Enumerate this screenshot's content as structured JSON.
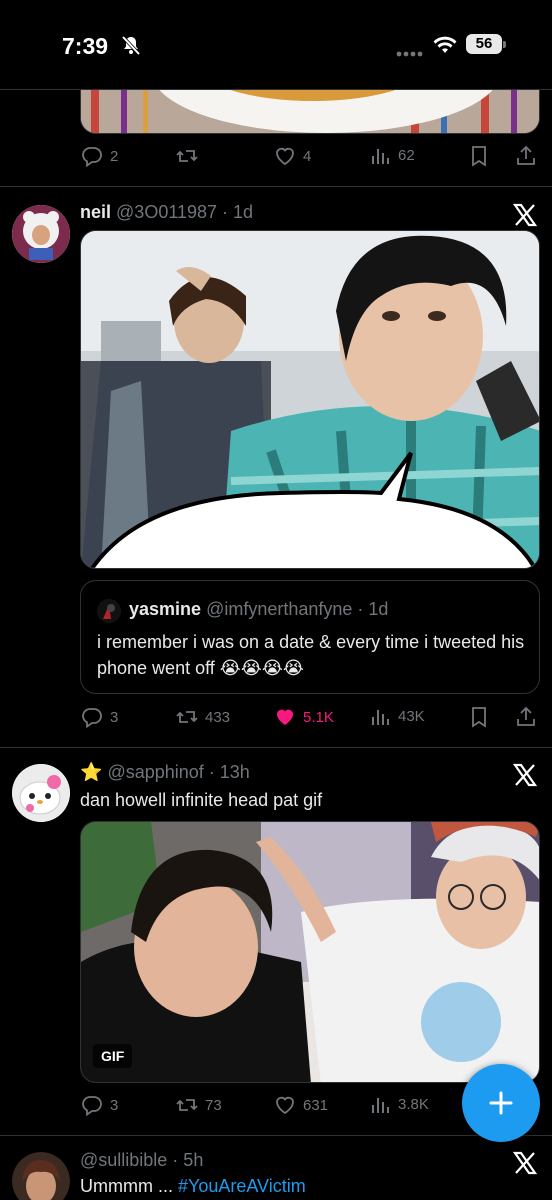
{
  "status_bar": {
    "time": "7:39",
    "battery": "56"
  },
  "tweet1": {
    "actions": {
      "replies": "2",
      "reposts": "",
      "likes": "4",
      "views": "62"
    }
  },
  "tweet2": {
    "name": "neil",
    "handle": "@3O011987 · 1d",
    "quote": {
      "name": "yasmine",
      "handle": "@imfynerthanfyne · 1d",
      "text": "i remember i was on a date & every time i tweeted his phone went off 😭😭😭😭"
    },
    "actions": {
      "replies": "3",
      "reposts": "433",
      "likes": "5.1K",
      "views": "43K"
    },
    "like_color": "#f91880"
  },
  "tweet3": {
    "name_emoji": "⭐",
    "handle": "@sapphinof · 13h",
    "text": "dan howell infinite head pat gif",
    "gif_label": "GIF",
    "actions": {
      "replies": "3",
      "reposts": "73",
      "likes": "631",
      "views": "3.8K"
    }
  },
  "tweet4": {
    "handle": "@sullibible · 5h",
    "text_prefix": "Ummmm ... ",
    "hashtag": "#YouAreAVictim"
  },
  "colors": {
    "accent": "#1d9bf0",
    "like": "#f91880",
    "muted": "#71767b",
    "divider": "#2f3336",
    "background": "#000000"
  },
  "icons": [
    "bell-slash-icon",
    "wifi-icon",
    "reply-icon",
    "repost-icon",
    "like-icon",
    "views-icon",
    "bookmark-icon",
    "share-icon",
    "x-logo-icon",
    "compose-plus-icon"
  ]
}
